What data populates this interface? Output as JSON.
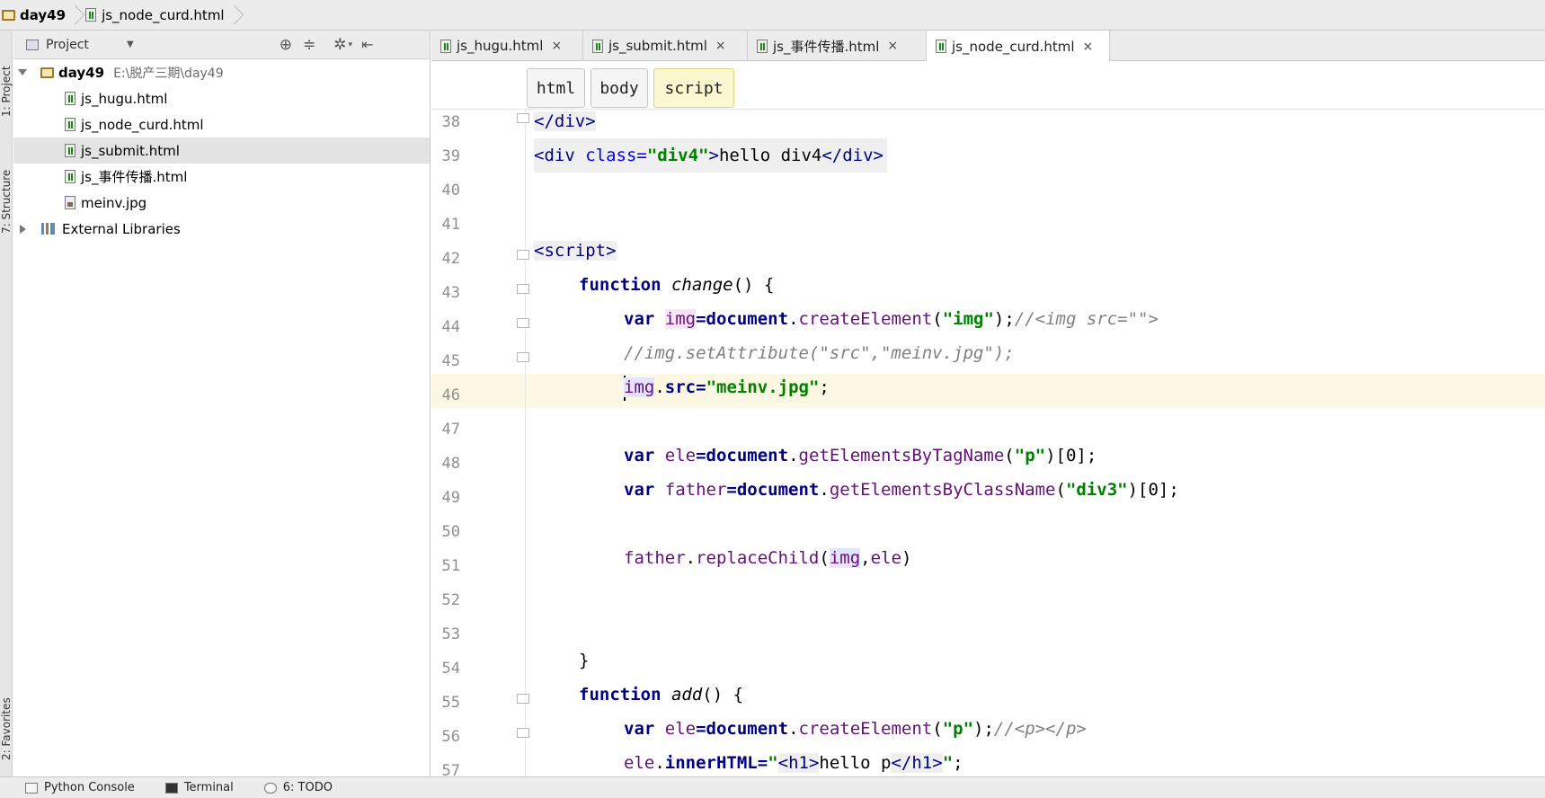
{
  "breadcrumb": {
    "project": "day49",
    "file": "js_node_curd.html"
  },
  "side_tabs": {
    "project": "1: Project",
    "structure": "7: Structure",
    "favorites": "2: Favorites"
  },
  "project_panel": {
    "title": "Project",
    "root": {
      "name": "day49",
      "path": "E:\\脱产三期\\day49"
    },
    "files": [
      {
        "name": "js_hugu.html",
        "type": "html"
      },
      {
        "name": "js_node_curd.html",
        "type": "html"
      },
      {
        "name": "js_submit.html",
        "type": "html",
        "selected": true
      },
      {
        "name": "js_事件传播.html",
        "type": "html"
      },
      {
        "name": "meinv.jpg",
        "type": "image"
      }
    ],
    "external": "External Libraries"
  },
  "tabs": [
    {
      "label": "js_hugu.html",
      "close": "×"
    },
    {
      "label": "js_submit.html",
      "close": "×"
    },
    {
      "label": "js_事件传播.html",
      "close": "×"
    },
    {
      "label": "js_node_curd.html",
      "close": "×",
      "active": true
    }
  ],
  "tag_breadcrumb": [
    "html",
    "body",
    "script"
  ],
  "line_numbers": [
    "38",
    "39",
    "40",
    "41",
    "42",
    "43",
    "44",
    "45",
    "46",
    "47",
    "48",
    "49",
    "50",
    "51",
    "52",
    "53",
    "54",
    "55",
    "56",
    "57"
  ],
  "code": {
    "l38": "</div>",
    "l39_open": "<div ",
    "l39_attr": "class=",
    "l39_val": "\"div4\"",
    "l39_close": ">",
    "l39_text": "hello div4",
    "l39_end": "</div>",
    "l42": "<script>",
    "l43_kw": "function ",
    "l43_fn": "change",
    "l43_rest": "() {",
    "l44_kw": "var ",
    "l44_var": "img",
    "l44_eq": "=",
    "l44_doc": "document",
    "l44_dot": ".",
    "l44_m": "createElement",
    "l44_p1": "(",
    "l44_str": "\"img\"",
    "l44_p2": ");",
    "l44_cm": "//<img src=\"\">",
    "l45_cm": "//img.setAttribute(\"src\",\"meinv.jpg\");",
    "l46_var": "img",
    "l46_dot": ".",
    "l46_prop": "src",
    "l46_eq": "=",
    "l46_str": "\"meinv.jpg\"",
    "l46_semi": ";",
    "l48_kw": "var ",
    "l48_var": "ele",
    "l48_eq": "=",
    "l48_doc": "document",
    "l48_dot": ".",
    "l48_m": "getElementsByTagName",
    "l48_p1": "(",
    "l48_str": "\"p\"",
    "l48_p2": ")[0];",
    "l49_kw": "var ",
    "l49_var": "father",
    "l49_eq": "=",
    "l49_doc": "document",
    "l49_dot": ".",
    "l49_m": "getElementsByClassName",
    "l49_p1": "(",
    "l49_str": "\"div3\"",
    "l49_p2": ")[0];",
    "l51_obj": "father",
    "l51_dot": ".",
    "l51_m": "replaceChild",
    "l51_p1": "(",
    "l51_a1": "img",
    "l51_comma": ",",
    "l51_a2": "ele",
    "l51_p2": ")",
    "l54": "}",
    "l55_kw": "function ",
    "l55_fn": "add",
    "l55_rest": "() {",
    "l56_kw": "var ",
    "l56_var": "ele",
    "l56_eq": "=",
    "l56_doc": "document",
    "l56_dot": ".",
    "l56_m": "createElement",
    "l56_p1": "(",
    "l56_str": "\"p\"",
    "l56_p2": ");",
    "l56_cm": "//<p></p>",
    "l57_obj": "ele",
    "l57_dot": ".",
    "l57_prop": "innerHTML",
    "l57_eq": "=",
    "l57_q1": "\"",
    "l57_t1": "<h1>",
    "l57_txt": "hello p",
    "l57_t2": "</h1>",
    "l57_q2": "\"",
    "l57_semi": ";"
  },
  "statusbar": {
    "python_console": "Python Console",
    "terminal": "Terminal",
    "todo": "6: TODO"
  },
  "colors": {
    "keyword": "#000080",
    "string": "#008000",
    "comment": "#808080",
    "current_line": "#fdf8e3"
  }
}
